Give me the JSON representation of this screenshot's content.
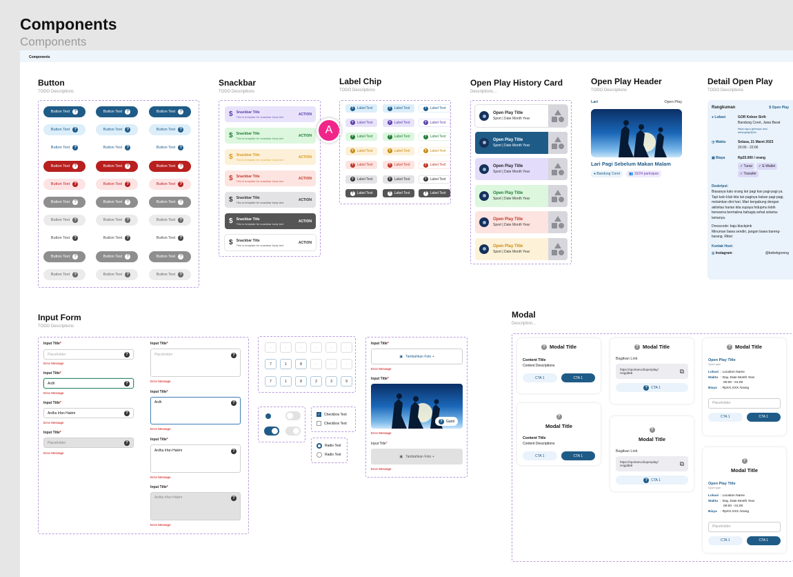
{
  "page": {
    "title": "Components",
    "subtitle": "Components",
    "frame_label": "Components"
  },
  "common": {
    "todo": "TODO Descriptions",
    "descriptions": "Descriptions...",
    "description": "Description...",
    "btn": "Button Text",
    "chip": "Label Text",
    "snack_title": "Snackbar Title",
    "snack_body": "This is template for snackbar body text",
    "action": "ACTION",
    "oph_title": "Open Play Title",
    "oph_sub": "Sport | Date Month Year",
    "input_title": "Input Title",
    "placeholder": "Placeholder",
    "error": "Error Message",
    "cta1": "CTA 1",
    "modal_title": "Modal Title",
    "content_title": "Content Title",
    "content_desc": "Content Descriptions",
    "bagikan": "Bagikan Link",
    "share_link": "https://sportsev.id/openplay/ H4gdd69",
    "q": "?"
  },
  "sections": {
    "button": "Button",
    "snackbar": "Snackbar",
    "label_chip": "Label Chip",
    "history": "Open Play History Card",
    "header": "Open Play Header",
    "detail": "Detail Open Play",
    "input": "Input Form",
    "modal": "Modal"
  },
  "avatar_letter": "A",
  "oph": {
    "sport": "Lari",
    "type": "Open Play",
    "name": "Lari Pagi Sebelum Makan Malam",
    "loc": "Bandung Coret",
    "part": "15/24 partisipan"
  },
  "detail": {
    "rangkuman": "Rangkuman",
    "badge": "Open Play",
    "lokasi_label": "Lokasi",
    "lokasi_name": "GOR Kebon Sirih",
    "lokasi_addr": "Bandung Coret, Jawa Barat",
    "lokasi_link": "https://goo.gl/maps/ asd-sfns/qsdjn2j2fa",
    "waktu_label": "Waktu",
    "waktu_date": "Selasa, 21 Maret 2023",
    "waktu_time": "20:00 - 22:00",
    "biaya_label": "Biaya",
    "biaya_price": "Rp25.000 / orang",
    "pay1": "Tunai",
    "pay2": "E-Wallet",
    "pay3": "Transfer",
    "desk_label": "Deskripsi:",
    "desk_text": "Biasanya kalo orang lari pagi kan pagi-pagi ya. Tapi kalo klub kita lari paginya bukan pagi-pagi, melainkan dini hari. Mari bergabung dengan aktivitas harian kita supaya hidupmu lebih berwarna bermakna bahagia sehat selama-lamanya.",
    "dress": "Dresscode: baju blackpink",
    "minum": "Minuman bawa sendiri, jangan bawa bareng-barang. Ribet",
    "kontak": "Kontak Host:",
    "ig": "Instagram",
    "handle": "@bebekgoreng"
  },
  "inputs": {
    "val1": "Ardh",
    "val2": "Ardha Irfan Hakim",
    "val3": "Ardh",
    "val4": "Ardha Irfan Hakim",
    "val5": "Ardha Irfan Hakim",
    "otp_dash": "-",
    "otp": [
      "7",
      "1",
      "8",
      "2",
      "3",
      "9"
    ],
    "cb1": "Checkbox Text",
    "cb2": "Checkbox Text",
    "rb1": "Radio Text",
    "rb2": "Radio Text",
    "foto": "Tambahkan Foto +",
    "ganti": "Ganti"
  },
  "modal": {
    "op_title": "Open Play Title",
    "sport_type": "Sport type",
    "lokasi": "Lokasi",
    "lokasi_v": ": Location Name",
    "waktu": "Waktu",
    "waktu_v": ": Day, Date Month Year",
    "waktu_t": "00:00 - 01:00",
    "biaya": "Biaya",
    "biaya_v": ": RpXX.XXX /orang"
  }
}
